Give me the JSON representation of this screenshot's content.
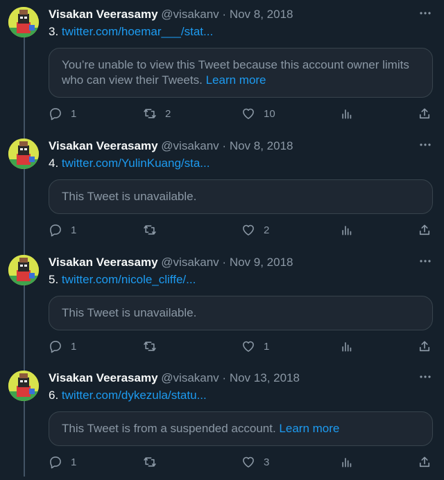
{
  "tweets": [
    {
      "name": "Visakan Veerasamy",
      "handle": "@visakanv",
      "separator": "·",
      "date": "Nov 8, 2018",
      "number": "3.",
      "link": "twitter.com/hoemar___/stat...",
      "notice": "You’re unable to view this Tweet because this account owner limits who can view their Tweets.",
      "learn_more": "Learn more",
      "replies": "1",
      "retweets": "2",
      "likes": "10"
    },
    {
      "name": "Visakan Veerasamy",
      "handle": "@visakanv",
      "separator": "·",
      "date": "Nov 8, 2018",
      "number": "4.",
      "link": "twitter.com/YulinKuang/sta...",
      "notice": "This Tweet is unavailable.",
      "learn_more": "",
      "replies": "1",
      "retweets": "",
      "likes": "2"
    },
    {
      "name": "Visakan Veerasamy",
      "handle": "@visakanv",
      "separator": "·",
      "date": "Nov 9, 2018",
      "number": "5.",
      "link": "twitter.com/nicole_cliffe/...",
      "notice": "This Tweet is unavailable.",
      "learn_more": "",
      "replies": "1",
      "retweets": "",
      "likes": "1"
    },
    {
      "name": "Visakan Veerasamy",
      "handle": "@visakanv",
      "separator": "·",
      "date": "Nov 13, 2018",
      "number": "6.",
      "link": "twitter.com/dykezula/statu...",
      "notice": "This Tweet is from a suspended account.",
      "learn_more": "Learn more",
      "replies": "1",
      "retweets": "",
      "likes": "3"
    }
  ],
  "icons": {
    "reply": "reply-icon",
    "retweet": "retweet-icon",
    "like": "heart-icon",
    "views": "analytics-icon",
    "share": "share-icon",
    "more": "more-icon"
  },
  "colors": {
    "background": "#15202b",
    "text": "#f7f9f9",
    "secondary": "#8b98a5",
    "link": "#1d9bf0",
    "card": "#1e2732",
    "border": "#38444d"
  }
}
